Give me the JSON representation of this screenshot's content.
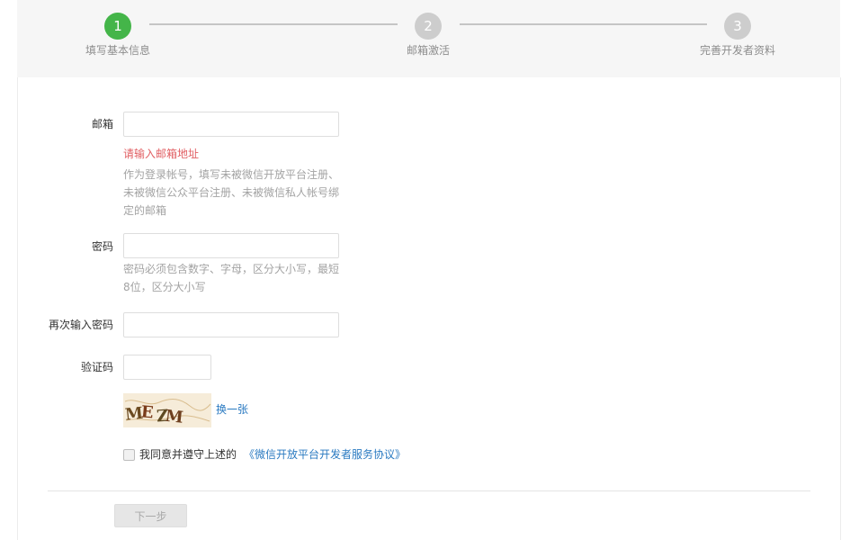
{
  "steps": [
    {
      "number": "1",
      "label": "填写基本信息",
      "state": "active"
    },
    {
      "number": "2",
      "label": "邮箱激活",
      "state": "todo"
    },
    {
      "number": "3",
      "label": "完善开发者资料",
      "state": "todo"
    }
  ],
  "colors": {
    "active_step": "#44b549",
    "inactive_step": "#cdcdcd",
    "error": "#e15f63",
    "link": "#2a7ac1"
  },
  "form": {
    "email": {
      "label": "邮箱",
      "value": "",
      "error": "请输入邮箱地址",
      "hint": "作为登录帐号，填写未被微信开放平台注册、未被微信公众平台注册、未被微信私人帐号绑定的邮箱"
    },
    "password": {
      "label": "密码",
      "value": "",
      "hint": "密码必须包含数字、字母，区分大小写，最短8位，区分大小写"
    },
    "confirm_password": {
      "label": "再次输入密码",
      "value": ""
    },
    "captcha": {
      "label": "验证码",
      "value": "",
      "image_text": "MEZM",
      "refresh_label": "换一张"
    },
    "agreement": {
      "checked": false,
      "text": "我同意并遵守上述的",
      "link_text": "《微信开放平台开发者服务协议》"
    },
    "next_button": "下一步"
  }
}
